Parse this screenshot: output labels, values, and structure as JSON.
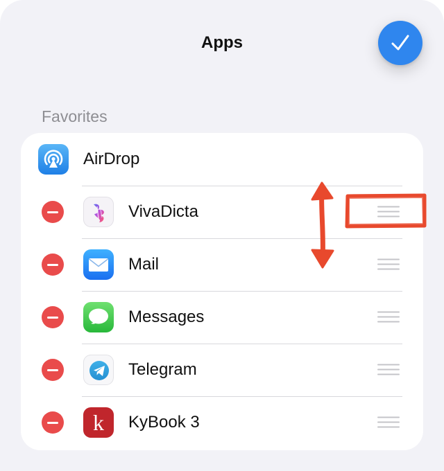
{
  "header": {
    "title": "Apps",
    "done_icon": "checkmark-icon"
  },
  "section": {
    "title": "Favorites"
  },
  "airdrop": {
    "label": "AirDrop",
    "icon": "airdrop-icon"
  },
  "apps": [
    {
      "label": "VivaDicta",
      "icon": "vivadicta-icon"
    },
    {
      "label": "Mail",
      "icon": "mail-icon"
    },
    {
      "label": "Messages",
      "icon": "messages-icon"
    },
    {
      "label": "Telegram",
      "icon": "telegram-icon"
    },
    {
      "label": "KyBook 3",
      "icon": "kybook-icon",
      "icon_letter": "k"
    }
  ],
  "colors": {
    "background": "#f2f2f7",
    "accent": "#2f86ee",
    "delete": "#e94b4b",
    "annotation": "#e8492d"
  }
}
